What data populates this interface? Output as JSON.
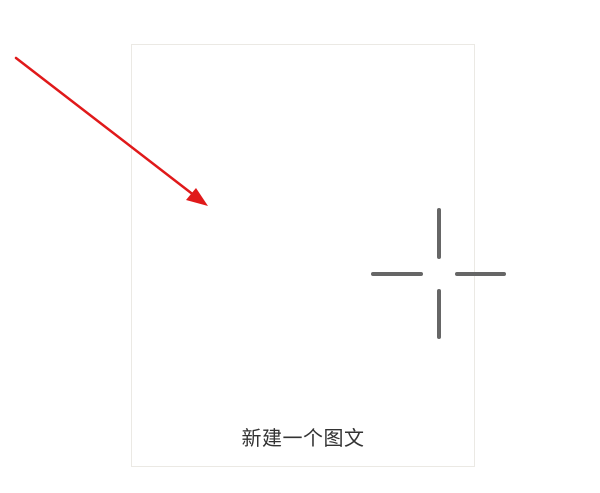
{
  "card": {
    "label": "新建一个图文",
    "icon": "plus-icon",
    "border_color": "#ebe9e4",
    "icon_color": "#666666"
  },
  "annotation": {
    "icon": "arrow-icon",
    "color": "#e0191a"
  }
}
